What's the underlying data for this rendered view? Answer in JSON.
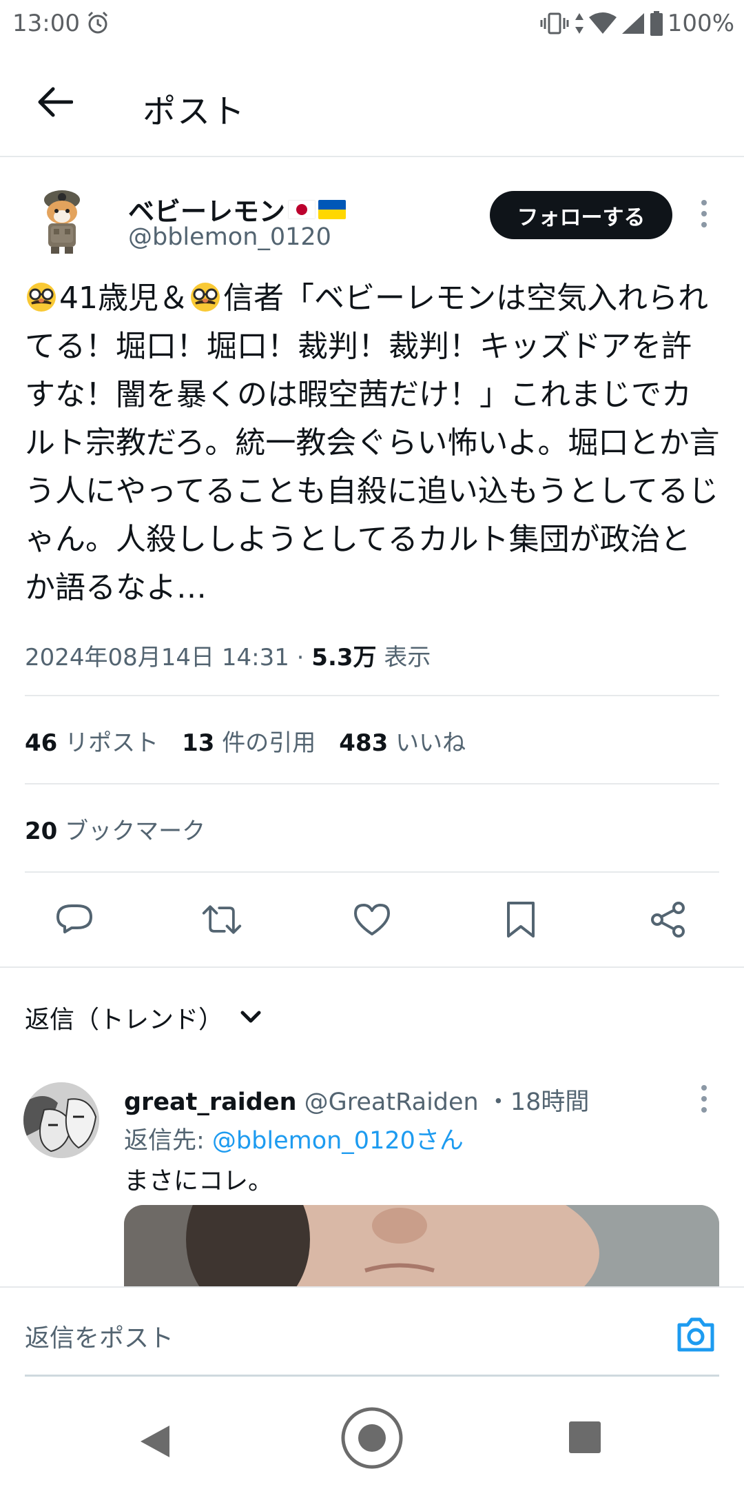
{
  "status_bar": {
    "time": "13:00",
    "battery": "100%",
    "icons": [
      "alarm-icon",
      "vibrate-icon",
      "data-arrows-icon",
      "wifi-icon",
      "signal-icon",
      "battery-icon"
    ]
  },
  "header": {
    "title": "ポスト",
    "back_icon": "arrow-left-icon"
  },
  "tweet": {
    "author_name": "ベビーレモン",
    "author_flags": [
      "jp-flag-icon",
      "ua-flag-icon"
    ],
    "handle": "@bblemon_0120",
    "follow_label": "フォローする",
    "text_part1": "41歳児＆",
    "text_part2": "信者「ベビーレモンは空気入れられてる！堀口！堀口！裁判！裁判！キッズドアを許すな！闇を暴くのは暇空茜だけ！」これまじでカルト宗教だろ。統一教会ぐらい怖いよ。堀口とか言う人にやってることも自殺に追い込もうとしてるじゃん。人殺ししようとしてるカルト集団が政治とか語るなよ…",
    "emoji": "disguised-face-emoji",
    "timestamp": "2024年08月14日 14:31",
    "views_count": "5.3万",
    "views_label": "表示",
    "reposts_count": "46",
    "reposts_label": "リポスト",
    "quotes_count": "13",
    "quotes_label": "件の引用",
    "likes_count": "483",
    "likes_label": "いいね",
    "bookmarks_count": "20",
    "bookmarks_label": "ブックマーク"
  },
  "actions": [
    "reply-icon",
    "repost-icon",
    "like-icon",
    "bookmark-icon",
    "share-icon"
  ],
  "replies": {
    "sort_label": "返信（トレンド）",
    "items": [
      {
        "name": "great_raiden",
        "handle": "@GreatRaiden",
        "time": "・18時間",
        "reply_to_label": "返信先: ",
        "reply_to_mention": "@bblemon_0120さん",
        "text": "まさにコレ。"
      }
    ]
  },
  "composer": {
    "placeholder": "返信をポスト",
    "camera_icon": "camera-icon"
  },
  "nav": [
    "nav-back-icon",
    "nav-home-icon",
    "nav-recents-icon"
  ],
  "colors": {
    "text": "#0f1419",
    "secondary": "#536471",
    "link": "#1d9bf0",
    "divider": "#e6e9eb"
  }
}
